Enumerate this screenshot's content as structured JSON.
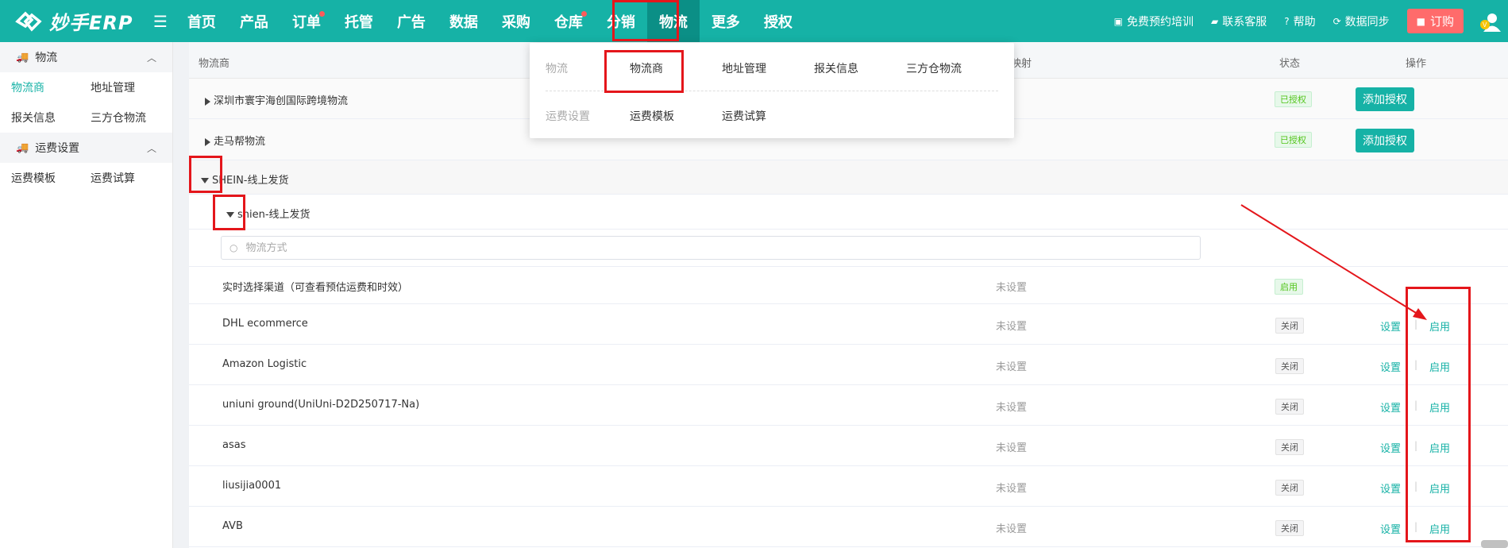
{
  "app": {
    "name": "妙手ERP"
  },
  "nav": {
    "items": [
      {
        "label": "首页",
        "dot": false
      },
      {
        "label": "产品",
        "dot": false
      },
      {
        "label": "订单",
        "dot": true
      },
      {
        "label": "托管",
        "dot": false
      },
      {
        "label": "广告",
        "dot": false
      },
      {
        "label": "数据",
        "dot": false
      },
      {
        "label": "采购",
        "dot": false
      },
      {
        "label": "仓库",
        "dot": true
      },
      {
        "label": "分销",
        "dot": false
      },
      {
        "label": "物流",
        "dot": false,
        "active": true
      },
      {
        "label": "更多",
        "dot": false
      },
      {
        "label": "授权",
        "dot": false
      }
    ]
  },
  "tools": {
    "training": "免费预约培训",
    "service": "联系客服",
    "help": "帮助",
    "sync": "数据同步",
    "order": "订购"
  },
  "sidebar": {
    "logistics_group": "物流",
    "links_row1": [
      "物流商",
      "地址管理"
    ],
    "links_row2": [
      "报关信息",
      "三方仓物流"
    ],
    "fee_group": "运费设置",
    "links_row3": [
      "运费模板",
      "运费试算"
    ]
  },
  "table": {
    "headers": {
      "provider": "物流商",
      "mapping": "映射",
      "status": "状态",
      "actions": "操作"
    },
    "providers": [
      {
        "name": "深圳市寰宇海创国际跨境物流",
        "status": "已授权",
        "action": "添加授权"
      },
      {
        "name": "走马帮物流",
        "status": "已授权",
        "action": "添加授权"
      }
    ],
    "expanded_provider": "SHEIN-线上发货",
    "sub_provider": "shien-线上发货",
    "search_placeholder": "物流方式",
    "realtime": {
      "name": "实时选择渠道（可查看预估运费和时效）",
      "mapping": "未设置",
      "status": "启用"
    },
    "methods": [
      {
        "name": "DHL ecommerce",
        "mapping": "未设置",
        "status": "关闭",
        "set": "设置",
        "enable": "启用"
      },
      {
        "name": "Amazon Logistic",
        "mapping": "未设置",
        "status": "关闭",
        "set": "设置",
        "enable": "启用"
      },
      {
        "name": "uniuni ground(UniUni-D2D250717-Na)",
        "mapping": "未设置",
        "status": "关闭",
        "set": "设置",
        "enable": "启用"
      },
      {
        "name": "asas",
        "mapping": "未设置",
        "status": "关闭",
        "set": "设置",
        "enable": "启用"
      },
      {
        "name": "liusijia0001",
        "mapping": "未设置",
        "status": "关闭",
        "set": "设置",
        "enable": "启用"
      },
      {
        "name": "AVB",
        "mapping": "未设置",
        "status": "关闭",
        "set": "设置",
        "enable": "启用"
      }
    ]
  },
  "dropdown": {
    "cat1": "物流",
    "row1": [
      "物流商",
      "地址管理",
      "报关信息",
      "三方仓物流"
    ],
    "cat2": "运费设置",
    "row2": [
      "运费模板",
      "运费试算"
    ]
  },
  "colors": {
    "primary": "#16b2a6",
    "annotation": "#e4161b"
  }
}
